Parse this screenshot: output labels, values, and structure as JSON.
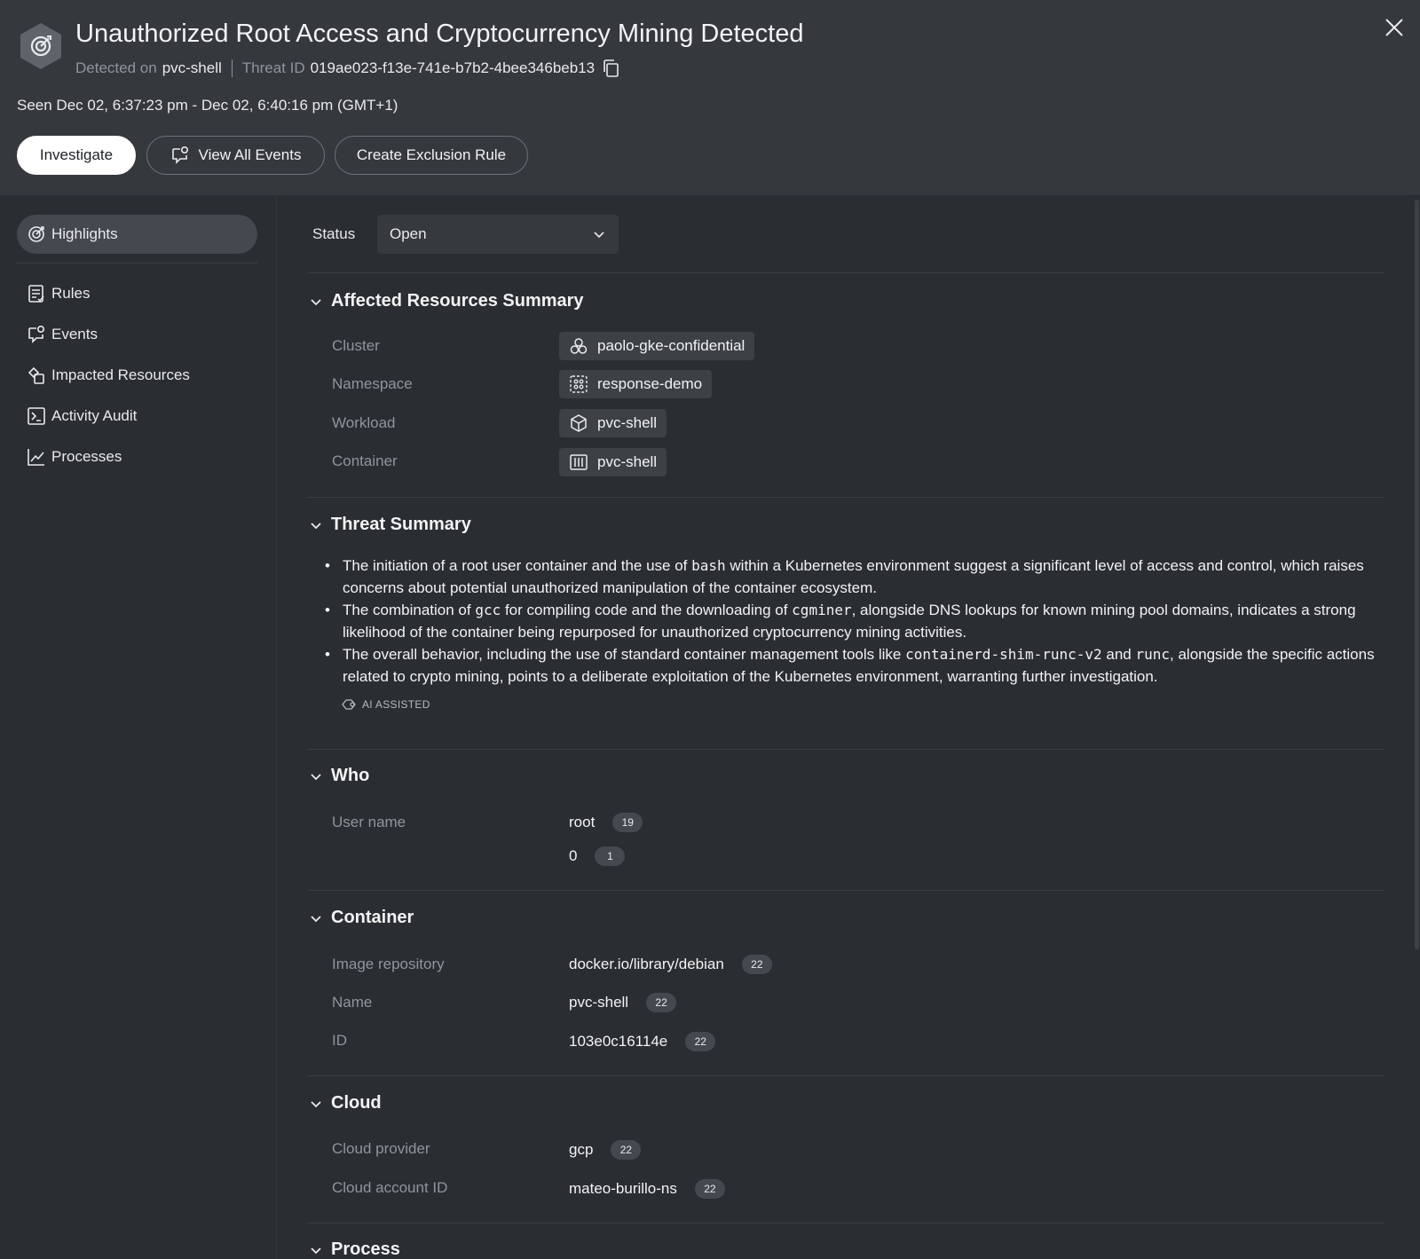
{
  "header": {
    "title": "Unauthorized Root Access and Cryptocurrency Mining Detected",
    "detected_on_label": "Detected on",
    "detected_on_value": "pvc-shell",
    "threat_id_label": "Threat ID",
    "threat_id_value": "019ae023-f13e-741e-b7b2-4bee346beb13",
    "seen": "Seen Dec 02, 6:37:23 pm - Dec 02, 6:40:16 pm (GMT+1)",
    "buttons": {
      "investigate": "Investigate",
      "view_all_events": "View All Events",
      "create_exclusion_rule": "Create Exclusion Rule"
    }
  },
  "sidebar": {
    "items": [
      {
        "label": "Highlights",
        "icon": "target-icon",
        "active": true
      },
      {
        "label": "Rules",
        "icon": "rules-icon"
      },
      {
        "label": "Events",
        "icon": "events-icon"
      },
      {
        "label": "Impacted Resources",
        "icon": "resources-icon"
      },
      {
        "label": "Activity Audit",
        "icon": "terminal-icon"
      },
      {
        "label": "Processes",
        "icon": "chart-line-icon"
      }
    ]
  },
  "status": {
    "label": "Status",
    "value": "Open"
  },
  "affected_resources": {
    "title": "Affected Resources Summary",
    "rows": [
      {
        "label": "Cluster",
        "value": "paolo-gke-confidential",
        "icon": "cluster-icon"
      },
      {
        "label": "Namespace",
        "value": "response-demo",
        "icon": "namespace-icon"
      },
      {
        "label": "Workload",
        "value": "pvc-shell",
        "icon": "cube-icon"
      },
      {
        "label": "Container",
        "value": "pvc-shell",
        "icon": "container-icon"
      }
    ]
  },
  "threat_summary": {
    "title": "Threat Summary",
    "bullet1": {
      "a": "The initiation of a root user container and the use of ",
      "code1": "bash",
      "b": " within a Kubernetes environment suggest a significant level of access and control, which raises concerns about potential unauthorized manipulation of the container ecosystem."
    },
    "bullet2": {
      "a": "The combination of ",
      "code1": "gcc",
      "b": " for compiling code and the downloading of ",
      "code2": "cgminer",
      "c": ", alongside DNS lookups for known mining pool domains, indicates a strong likelihood of the container being repurposed for unauthorized cryptocurrency mining activities."
    },
    "bullet3": {
      "a": "The overall behavior, including the use of standard container management tools like ",
      "code1": "containerd-shim-runc-v2",
      "b": " and ",
      "code2": "runc",
      "c": ", alongside the specific actions related to crypto mining, points to a deliberate exploitation of the Kubernetes environment, warranting further investigation."
    },
    "ai_badge": "AI ASSISTED"
  },
  "who": {
    "title": "Who",
    "label": "User name",
    "values": [
      {
        "value": "root",
        "count": "19"
      },
      {
        "value": "0",
        "count": "1"
      }
    ]
  },
  "container": {
    "title": "Container",
    "rows": [
      {
        "label": "Image repository",
        "value": "docker.io/library/debian",
        "count": "22"
      },
      {
        "label": "Name",
        "value": "pvc-shell",
        "count": "22"
      },
      {
        "label": "ID",
        "value": "103e0c16114e",
        "count": "22"
      }
    ]
  },
  "cloud": {
    "title": "Cloud",
    "rows": [
      {
        "label": "Cloud provider",
        "value": "gcp",
        "count": "22"
      },
      {
        "label": "Cloud account ID",
        "value": "mateo-burillo-ns",
        "count": "22"
      }
    ]
  },
  "process": {
    "title": "Process"
  }
}
